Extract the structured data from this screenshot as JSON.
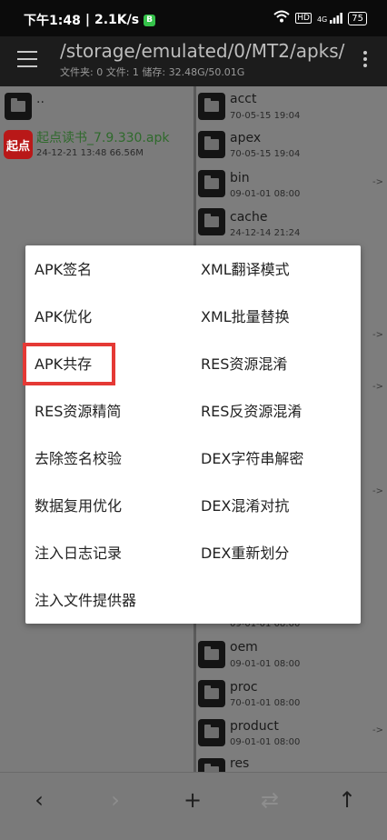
{
  "status": {
    "time": "下午1:48",
    "net_speed": "2.1K/s",
    "app_badge": "B",
    "hd": "HD",
    "net_type": "4G",
    "battery": "75"
  },
  "toolbar": {
    "path": "/storage/emulated/0/MT2/apks/",
    "info": "文件夹: 0  文件: 1  储存: 32.48G/50.01G"
  },
  "left_pane": {
    "parent_label": "..",
    "apk": {
      "icon_text": "起点",
      "name": "起点读书_7.9.330.apk",
      "meta": "24-12-21 13:48  66.56M"
    }
  },
  "right_pane": {
    "items": [
      {
        "name": "acct",
        "meta": "70-05-15 19:04",
        "arrow": ""
      },
      {
        "name": "apex",
        "meta": "70-05-15 19:04",
        "arrow": ""
      },
      {
        "name": "bin",
        "meta": "09-01-01 08:00",
        "arrow": "->"
      },
      {
        "name": "cache",
        "meta": "24-12-14 21:24",
        "arrow": ""
      },
      {
        "name": "oem",
        "meta": "09-01-01 08:00",
        "arrow": ""
      },
      {
        "name": "proc",
        "meta": "70-01-01 08:00",
        "arrow": ""
      },
      {
        "name": "product",
        "meta": "09-01-01 08:00",
        "arrow": "->"
      },
      {
        "name": "res",
        "meta": "",
        "arrow": ""
      }
    ],
    "partial_meta": "09-01-01 08:00",
    "side_arrows": [
      "->",
      "->",
      "->"
    ]
  },
  "menu": {
    "items": [
      "APK签名",
      "XML翻译模式",
      "APK优化",
      "XML批量替换",
      "APK共存",
      "RES资源混淆",
      "RES资源精简",
      "RES反资源混淆",
      "去除签名校验",
      "DEX字符串解密",
      "数据复用优化",
      "DEX混淆对抗",
      "注入日志记录",
      "DEX重新划分",
      "注入文件提供器"
    ]
  },
  "bottom": {
    "back": "‹",
    "forward": "›",
    "add": "+",
    "swap": "⇄",
    "up": "↑"
  }
}
